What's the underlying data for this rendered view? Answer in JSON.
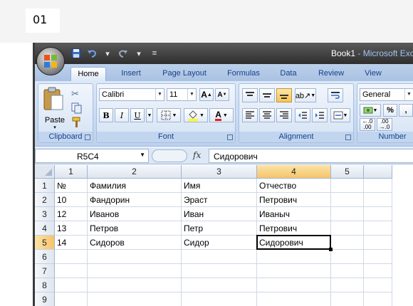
{
  "page_label": "01",
  "window": {
    "doc_title": "Book1",
    "separator": " - ",
    "app_title": "Microsoft Exce"
  },
  "tabs": [
    "Home",
    "Insert",
    "Page Layout",
    "Formulas",
    "Data",
    "Review",
    "View"
  ],
  "active_tab": "Home",
  "ribbon": {
    "clipboard": {
      "label": "Clipboard",
      "paste_label": "Paste"
    },
    "font": {
      "label": "Font",
      "font_name": "Calibri",
      "font_size": "11",
      "bold": "B",
      "italic": "I",
      "underline": "U"
    },
    "alignment": {
      "label": "Alignment"
    },
    "number": {
      "label": "Number",
      "format": "General",
      "percent": "%",
      "comma": ","
    }
  },
  "formula_bar": {
    "name_box": "R5C4",
    "fx_label": "fx",
    "value": "Сидорович"
  },
  "grid": {
    "columns": [
      "1",
      "2",
      "3",
      "4",
      "5"
    ],
    "rows": [
      "1",
      "2",
      "3",
      "4",
      "5",
      "6",
      "7",
      "8",
      "9"
    ],
    "cells": [
      [
        "№",
        "Фамилия",
        "Имя",
        "Отчество",
        ""
      ],
      [
        "10",
        "Фандорин",
        "Эраст",
        "Петрович",
        ""
      ],
      [
        "12",
        "Иванов",
        "Иван",
        "Иваныч",
        ""
      ],
      [
        "13",
        "Петров",
        "Петр",
        "Петрович",
        ""
      ],
      [
        "14",
        "Сидоров",
        "Сидор",
        "Сидорович",
        ""
      ],
      [
        "",
        "",
        "",
        "",
        ""
      ],
      [
        "",
        "",
        "",
        "",
        ""
      ],
      [
        "",
        "",
        "",
        "",
        ""
      ],
      [
        "",
        "",
        "",
        "",
        ""
      ]
    ],
    "selected_row": 5,
    "selected_col": 4
  },
  "colors": {
    "ribbon_text": "#15428b",
    "selected_header": "#f6c46b",
    "title_bar": "#2e2e2e"
  }
}
